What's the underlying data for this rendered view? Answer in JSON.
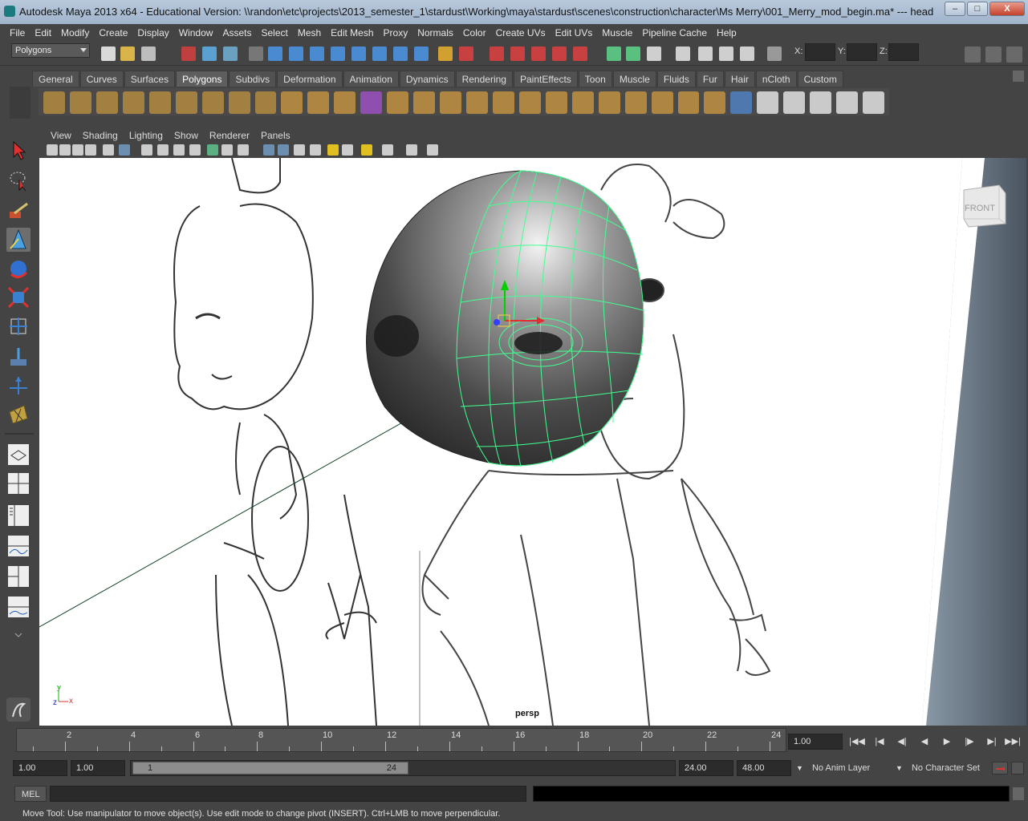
{
  "window": {
    "title": "Autodesk Maya 2013 x64 - Educational Version: \\\\randon\\etc\\projects\\2013_semester_1\\stardust\\Working\\maya\\stardust\\scenes\\construction\\character\\Ms Merry\\001_Merry_mod_begin.ma*   ---   head",
    "minimize": "–",
    "maximize": "□",
    "close": "X"
  },
  "menubar": [
    "File",
    "Edit",
    "Modify",
    "Create",
    "Display",
    "Window",
    "Assets",
    "Select",
    "Mesh",
    "Edit Mesh",
    "Proxy",
    "Normals",
    "Color",
    "Create UVs",
    "Edit UVs",
    "Muscle",
    "Pipeline Cache",
    "Help"
  ],
  "statusline": {
    "mode": "Polygons",
    "x_label": "X:",
    "y_label": "Y:",
    "z_label": "Z:"
  },
  "shelf": {
    "tabs": [
      "General",
      "Curves",
      "Surfaces",
      "Polygons",
      "Subdivs",
      "Deformation",
      "Animation",
      "Dynamics",
      "Rendering",
      "PaintEffects",
      "Toon",
      "Muscle",
      "Fluids",
      "Fur",
      "Hair",
      "nCloth",
      "Custom"
    ],
    "active_tab": "Polygons"
  },
  "panel": {
    "menus": [
      "View",
      "Shading",
      "Lighting",
      "Show",
      "Renderer",
      "Panels"
    ],
    "camera": "persp",
    "viewcube_label": "FRONT",
    "axis_y": "y",
    "axis_z": "z",
    "axis_x": "x"
  },
  "timeslider": {
    "labels": [
      "2",
      "4",
      "6",
      "8",
      "10",
      "12",
      "14",
      "16",
      "18",
      "20",
      "22",
      "24"
    ],
    "current_frame": "1.00"
  },
  "range": {
    "start": "1.00",
    "playback_start": "1.00",
    "handle_start": "1",
    "handle_end": "24",
    "playback_end": "24.00",
    "end": "48.00",
    "anim_layer": "No Anim Layer",
    "character_set": "No Character Set"
  },
  "cmdline": {
    "language": "MEL"
  },
  "helpline": "Move Tool: Use manipulator to move object(s). Use edit mode to change pivot (INSERT).  Ctrl+LMB to move perpendicular.",
  "colors": {
    "ui_bg": "#444444",
    "wire": "#40ff90",
    "manip_y": "#00d000",
    "manip_x": "#e03030",
    "manip_z": "#3040ff"
  }
}
